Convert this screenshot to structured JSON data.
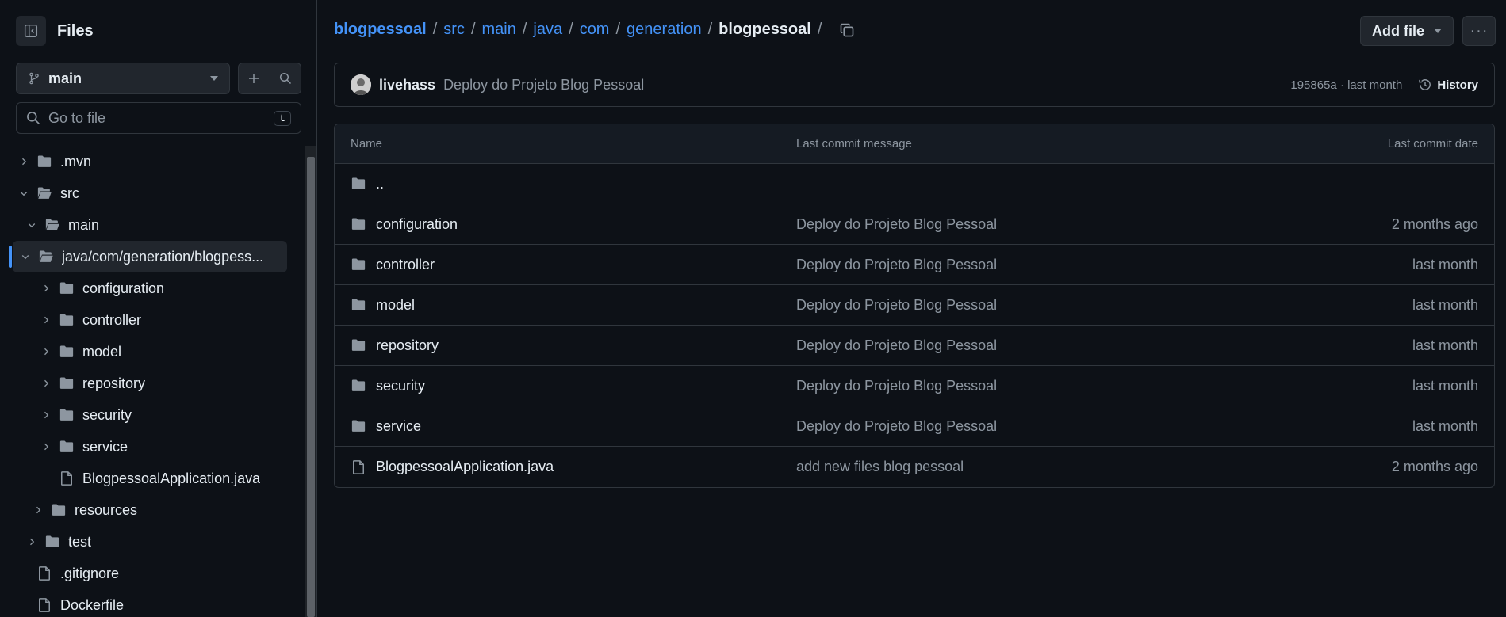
{
  "sidebar": {
    "title": "Files",
    "branch": "main",
    "search_placeholder": "Go to file",
    "search_shortcut": "t",
    "tree": [
      {
        "label": ".mvn",
        "type": "folder",
        "expanded": false
      },
      {
        "label": "src",
        "type": "folder",
        "expanded": true
      },
      {
        "label": "main",
        "type": "folder",
        "expanded": true
      },
      {
        "label": "java/com/generation/blogpess...",
        "type": "folder",
        "expanded": true,
        "active": true
      },
      {
        "label": "configuration",
        "type": "folder",
        "expanded": false
      },
      {
        "label": "controller",
        "type": "folder",
        "expanded": false
      },
      {
        "label": "model",
        "type": "folder",
        "expanded": false
      },
      {
        "label": "repository",
        "type": "folder",
        "expanded": false
      },
      {
        "label": "security",
        "type": "folder",
        "expanded": false
      },
      {
        "label": "service",
        "type": "folder",
        "expanded": false
      },
      {
        "label": "BlogpessoalApplication.java",
        "type": "file"
      },
      {
        "label": "resources",
        "type": "folder",
        "expanded": false
      },
      {
        "label": "test",
        "type": "folder",
        "expanded": false
      },
      {
        "label": ".gitignore",
        "type": "file"
      },
      {
        "label": "Dockerfile",
        "type": "file"
      }
    ]
  },
  "breadcrumb": {
    "repo": "blogpessoal",
    "parts": [
      "src",
      "main",
      "java",
      "com",
      "generation"
    ],
    "current": "blogpessoal",
    "trailing": "/"
  },
  "toolbar": {
    "add_file_label": "Add file",
    "more_label": "···"
  },
  "commit": {
    "author": "livehass",
    "message": "Deploy do Projeto Blog Pessoal",
    "sha_time": "195865a · last month",
    "history_label": "History"
  },
  "table": {
    "headers": {
      "name": "Name",
      "message": "Last commit message",
      "date": "Last commit date"
    },
    "parent_label": "..",
    "rows": [
      {
        "name": "configuration",
        "type": "folder",
        "message": "Deploy do Projeto Blog Pessoal",
        "date": "2 months ago"
      },
      {
        "name": "controller",
        "type": "folder",
        "message": "Deploy do Projeto Blog Pessoal",
        "date": "last month"
      },
      {
        "name": "model",
        "type": "folder",
        "message": "Deploy do Projeto Blog Pessoal",
        "date": "last month"
      },
      {
        "name": "repository",
        "type": "folder",
        "message": "Deploy do Projeto Blog Pessoal",
        "date": "last month"
      },
      {
        "name": "security",
        "type": "folder",
        "message": "Deploy do Projeto Blog Pessoal",
        "date": "last month"
      },
      {
        "name": "service",
        "type": "folder",
        "message": "Deploy do Projeto Blog Pessoal",
        "date": "last month"
      },
      {
        "name": "BlogpessoalApplication.java",
        "type": "file",
        "message": "add new files blog pessoal",
        "date": "2 months ago"
      }
    ]
  },
  "colors": {
    "background": "#0d1117",
    "link": "#4493f8",
    "muted": "#8d96a0",
    "border": "#30363d"
  }
}
